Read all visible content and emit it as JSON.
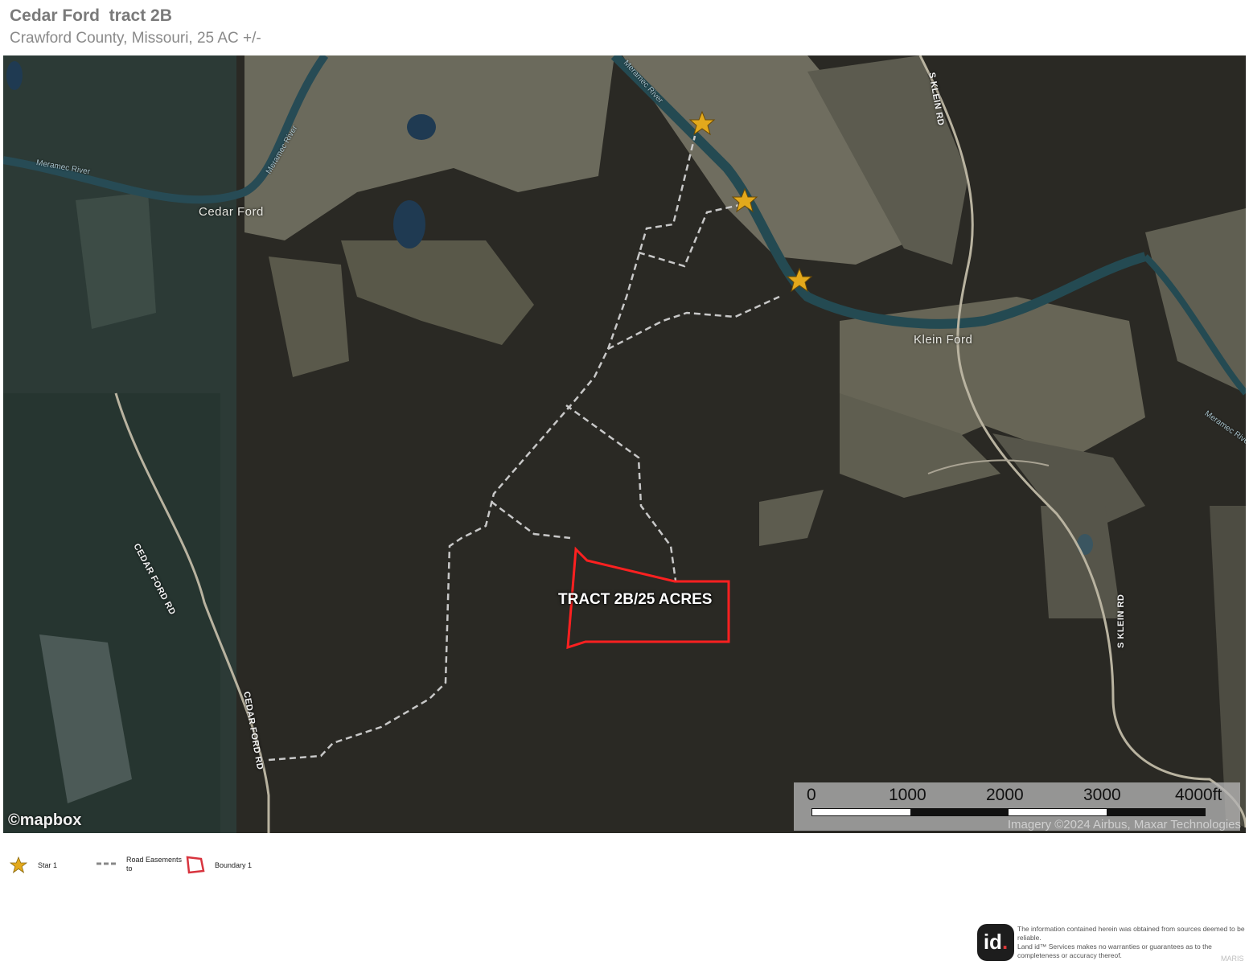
{
  "header": {
    "title": "Cedar Ford  tract 2B",
    "subtitle": "Crawford County, Missouri, 25 AC +/-"
  },
  "map": {
    "places": {
      "cedar_ford": "Cedar Ford",
      "klein_ford": "Klein Ford"
    },
    "roads": {
      "cedar_ford_rd": "CEDAR FORD RD",
      "s_klein_rd": "S KLEIN RD"
    },
    "river": "Meramec River",
    "tract_label": "TRACT 2B/25 ACRES",
    "scale": {
      "ticks": [
        "0",
        "1000",
        "2000",
        "3000",
        "4000ft"
      ]
    },
    "imagery_credit": "Imagery ©2024 Airbus, Maxar Technologies",
    "attribution": "©mapbox",
    "colors": {
      "boundary": "#ff2020",
      "easement": "#c8c8c8",
      "star": "#e3a91c"
    }
  },
  "legend": {
    "star_label": "Star 1",
    "easement_label": "Road Easements to",
    "boundary_label": "Boundary 1"
  },
  "footer": {
    "logo_text": "id",
    "disclaimer_1": "The information contained herein was obtained from sources deemed to be reliable.",
    "disclaimer_2": "Land id™ Services makes no warranties or guarantees as to the completeness or accuracy thereof.",
    "watermark": "MARIS"
  }
}
